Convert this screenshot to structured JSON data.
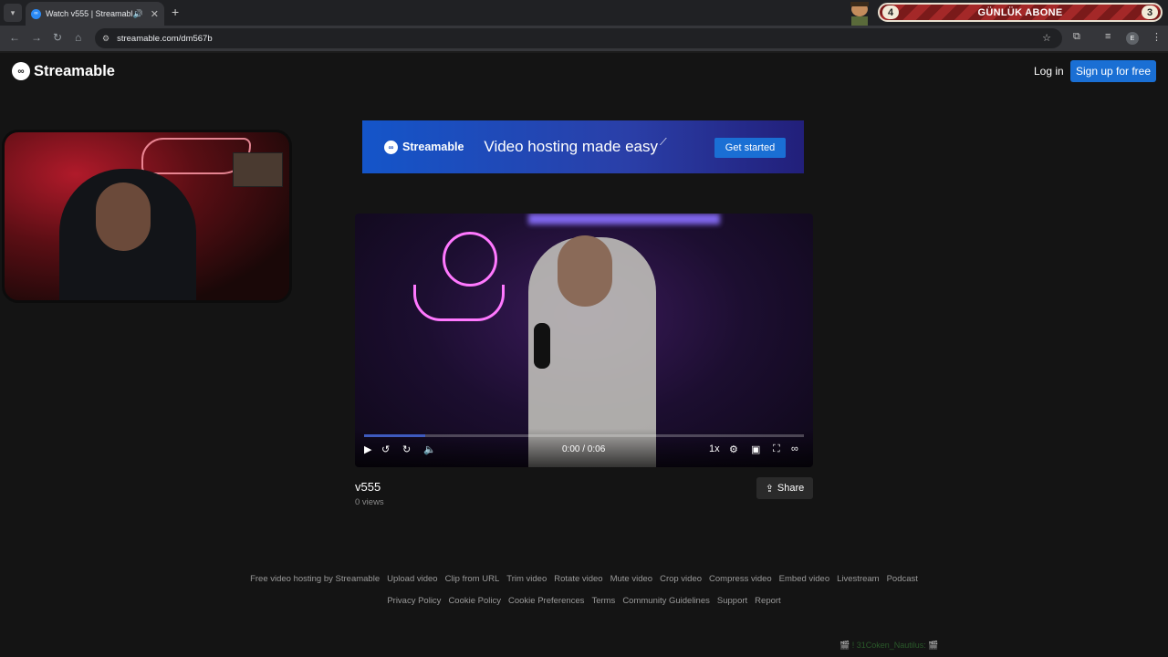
{
  "browser": {
    "tab_title": "Watch v555 | Streamable",
    "url": "streamable.com/dm567b",
    "profile_initial": "E"
  },
  "overlay": {
    "abone_left": "4",
    "abone_label": "GÜNLÜK ABONE",
    "abone_right": "3",
    "chat": "🎬 ! 31Coken_Nautilus: 🎬"
  },
  "header": {
    "brand": "Streamable",
    "login_label": "Log in",
    "signup_label": "Sign up for free"
  },
  "ad": {
    "brand": "Streamable",
    "tagline": "Video hosting made easy",
    "cta": "Get started"
  },
  "player": {
    "time": "0:00 / 0:06",
    "speed": "1x",
    "progress": 0
  },
  "video": {
    "title": "v555",
    "views": "0 views",
    "share_label": "Share"
  },
  "footer": {
    "row1": [
      "Free video hosting by Streamable",
      "Upload video",
      "Clip from URL",
      "Trim video",
      "Rotate video",
      "Mute video",
      "Crop video",
      "Compress video",
      "Embed video",
      "Livestream",
      "Podcast"
    ],
    "row2": [
      "Privacy Policy",
      "Cookie Policy",
      "Cookie Preferences",
      "Terms",
      "Community Guidelines",
      "Support",
      "Report"
    ]
  },
  "colors": {
    "accent": "#1a6fd4",
    "background": "#141414"
  }
}
